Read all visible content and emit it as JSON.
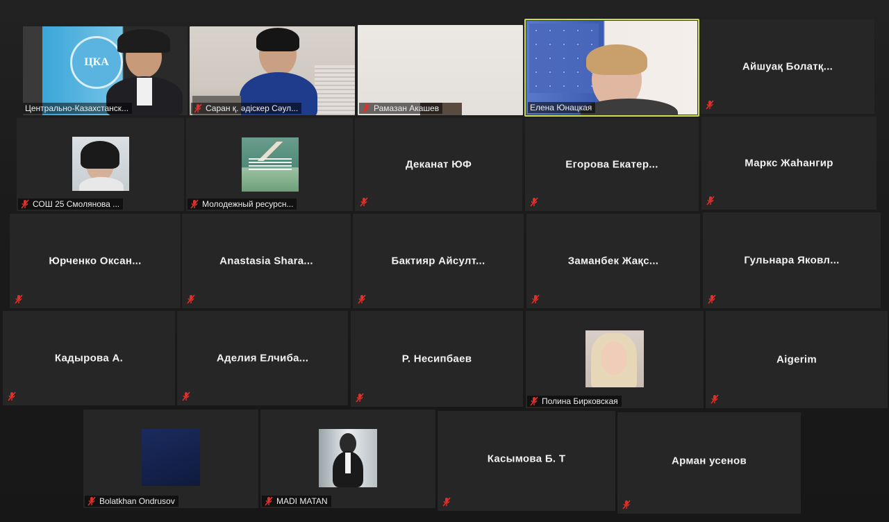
{
  "participants": [
    {
      "name": "Центрально-Казахстанск...",
      "video": true,
      "active": false,
      "logo": "ЦКА"
    },
    {
      "name": "Саран қ. әдіскер Сәул...",
      "video": true,
      "active": false
    },
    {
      "name": "Рамазан Акашев",
      "video": true,
      "active": false
    },
    {
      "name": "Елена Юнацкая",
      "video": true,
      "active": true
    },
    {
      "name": "Айшуақ Болатқ...",
      "video": false
    },
    {
      "name": "СОШ 25 Смолянова ...",
      "video": false,
      "thumbnail": "photo"
    },
    {
      "name": "Молодежный ресурсн...",
      "video": false,
      "thumbnail": "poster"
    },
    {
      "name": "Деканат ЮФ",
      "video": false
    },
    {
      "name": "Егорова Екатер...",
      "video": false
    },
    {
      "name": "Маркс Жаһангир",
      "video": false
    },
    {
      "name": "Юрченко Оксан...",
      "video": false
    },
    {
      "name": "Anastasia Shara...",
      "video": false
    },
    {
      "name": "Бактияр Айсулт...",
      "video": false
    },
    {
      "name": "Заманбек Жақс...",
      "video": false
    },
    {
      "name": "Гульнара Яковл...",
      "video": false
    },
    {
      "name": "Кадырова А.",
      "video": false
    },
    {
      "name": "Аделия Елчиба...",
      "video": false
    },
    {
      "name": "Р. Несипбаев",
      "video": false
    },
    {
      "name": "Полина Бирковская",
      "video": false,
      "thumbnail": "photo"
    },
    {
      "name": "Aigerim",
      "video": false
    },
    {
      "name": "Bolatkhan Ondrusov",
      "video": false,
      "thumbnail": "dark-blue"
    },
    {
      "name": "MADI MATAN",
      "video": false,
      "thumbnail": "photo"
    },
    {
      "name": "Касымова Б. Т",
      "video": false
    },
    {
      "name": "Арман усенов",
      "video": false
    }
  ],
  "colors": {
    "tile_bg": "#262626",
    "active_border": "#cfe04a",
    "mute_icon": "#e0302a"
  },
  "icons": {
    "mute": "microphone-muted-icon"
  }
}
